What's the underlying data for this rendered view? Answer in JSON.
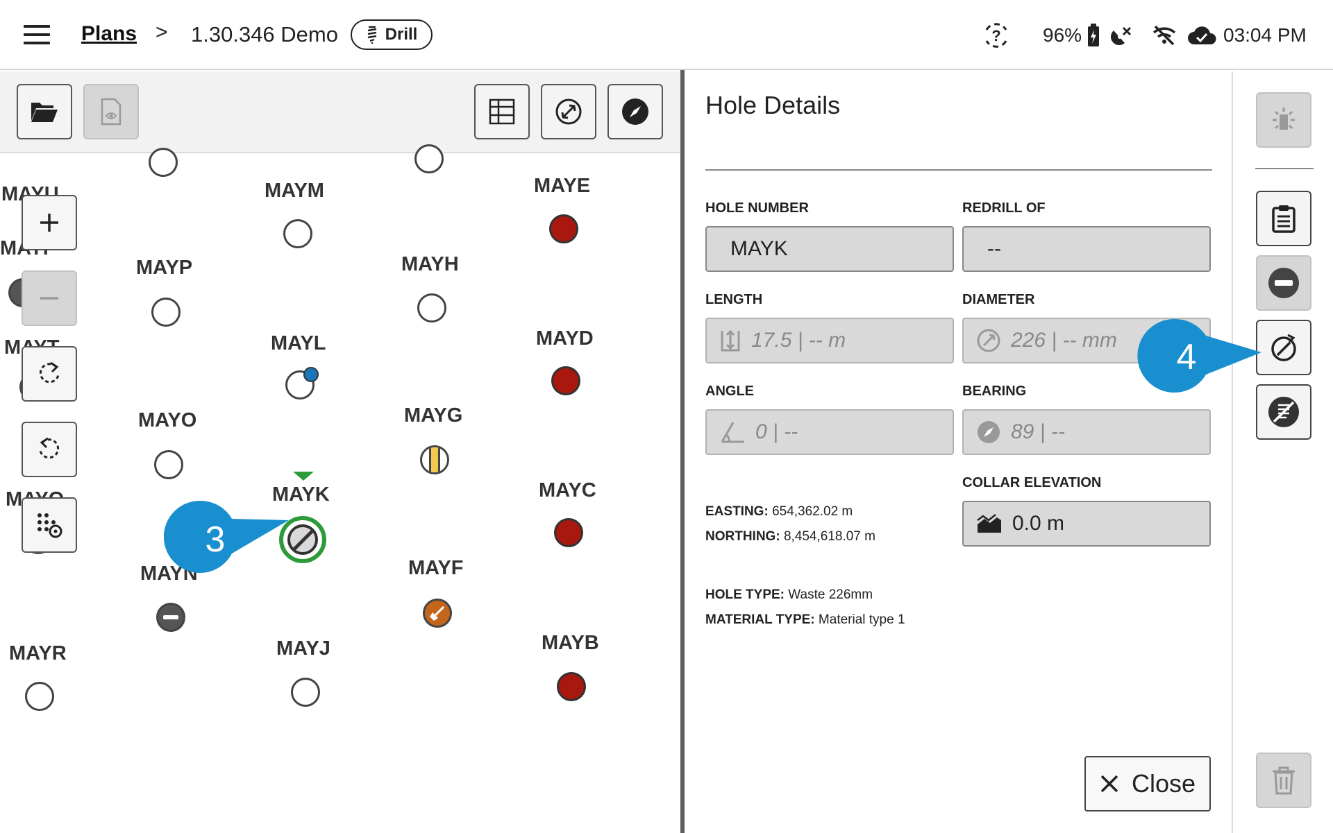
{
  "topbar": {
    "breadcrumb_root": "Plans",
    "breadcrumb_sep": ">",
    "plan_name": "1.30.346 Demo",
    "mode_label": "Drill",
    "battery": "96%",
    "time": "03:04 PM"
  },
  "map": {
    "holes": [
      {
        "label": "MAYM",
        "state": "empty"
      },
      {
        "label": "MAYE",
        "state": "red"
      },
      {
        "label": "MAYP",
        "state": "empty"
      },
      {
        "label": "MAYH",
        "state": "empty"
      },
      {
        "label": "MAYL",
        "state": "empty-blue-dot"
      },
      {
        "label": "MAYD",
        "state": "red"
      },
      {
        "label": "MAYO",
        "state": "empty"
      },
      {
        "label": "MAYG",
        "state": "yellow-split"
      },
      {
        "label": "MAYK",
        "state": "selected-slashed"
      },
      {
        "label": "MAYC",
        "state": "red"
      },
      {
        "label": "MAYN",
        "state": "minus"
      },
      {
        "label": "MAYF",
        "state": "orange-shovel"
      },
      {
        "label": "MAYR",
        "state": "empty"
      },
      {
        "label": "MAYJ",
        "state": "empty"
      },
      {
        "label": "MAYB",
        "state": "red"
      }
    ],
    "partial_labels": [
      "MAYU",
      "MAYI",
      "MAYT",
      "MAYQ"
    ],
    "callout_3": "3"
  },
  "details": {
    "title": "Hole Details",
    "hole_number_label": "HOLE NUMBER",
    "hole_number_value": "MAYK",
    "redrill_label": "REDRILL OF",
    "redrill_value": "--",
    "length_label": "LENGTH",
    "length_value": "17.5 | -- m",
    "diameter_label": "DIAMETER",
    "diameter_value": "226 | -- mm",
    "angle_label": "ANGLE",
    "angle_value": "0 | --",
    "bearing_label": "BEARING",
    "bearing_value": "89 | --",
    "collar_label": "COLLAR ELEVATION",
    "collar_value": "0.0 m",
    "easting_label": "EASTING:",
    "easting_value": "654,362.02 m",
    "northing_label": "NORTHING:",
    "northing_value": "8,454,618.07 m",
    "hole_type_label": "HOLE TYPE:",
    "hole_type_value": "Waste 226mm",
    "material_type_label": "MATERIAL TYPE:",
    "material_type_value": "Material type 1",
    "close_label": "Close",
    "callout_4": "4"
  },
  "colors": {
    "callout": "#1a8fd0",
    "hole_red": "#a8180f",
    "selected_ring": "#2e9b3a",
    "blue_dot": "#1976b8",
    "shovel_orange": "#c4651c",
    "split_yellow": "#f2c94c"
  }
}
